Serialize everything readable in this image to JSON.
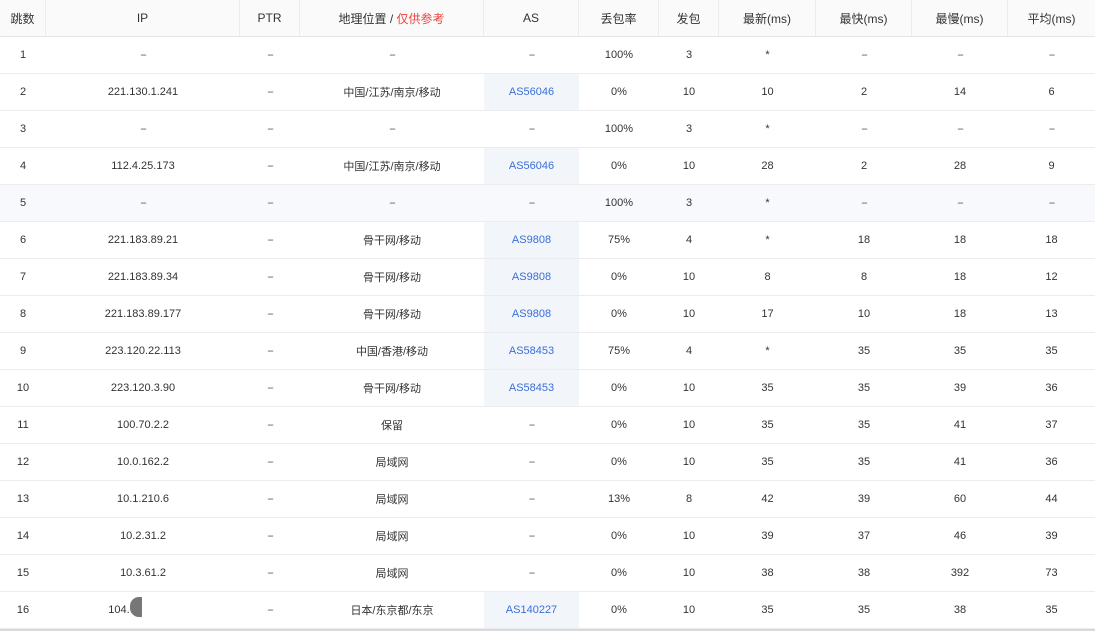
{
  "header": {
    "hop": "跳数",
    "ip": "IP",
    "ptr": "PTR",
    "geo": "地理位置 / ",
    "geo_note": "仅供参考",
    "as": "AS",
    "loss": "丢包率",
    "sent": "发包",
    "last": "最新(ms)",
    "best": "最快(ms)",
    "worst": "最慢(ms)",
    "avg": "平均(ms)"
  },
  "rows": [
    {
      "hop": "1",
      "ip": "--",
      "ptr": "--",
      "geo": "--",
      "as": "--",
      "loss": "100%",
      "sent": "3",
      "last": "*",
      "best": "--",
      "worst": "--",
      "avg": "--"
    },
    {
      "hop": "2",
      "ip": "221.130.1.241",
      "ptr": "--",
      "geo": "中国/江苏/南京/移动",
      "as": "AS56046",
      "loss": "0%",
      "sent": "10",
      "last": "10",
      "best": "2",
      "worst": "14",
      "avg": "6"
    },
    {
      "hop": "3",
      "ip": "--",
      "ptr": "--",
      "geo": "--",
      "as": "--",
      "loss": "100%",
      "sent": "3",
      "last": "*",
      "best": "--",
      "worst": "--",
      "avg": "--"
    },
    {
      "hop": "4",
      "ip": "112.4.25.173",
      "ptr": "--",
      "geo": "中国/江苏/南京/移动",
      "as": "AS56046",
      "loss": "0%",
      "sent": "10",
      "last": "28",
      "best": "2",
      "worst": "28",
      "avg": "9"
    },
    {
      "hop": "5",
      "ip": "--",
      "ptr": "--",
      "geo": "--",
      "as": "--",
      "loss": "100%",
      "sent": "3",
      "last": "*",
      "best": "--",
      "worst": "--",
      "avg": "--"
    },
    {
      "hop": "6",
      "ip": "221.183.89.21",
      "ptr": "--",
      "geo": "骨干网/移动",
      "as": "AS9808",
      "loss": "75%",
      "sent": "4",
      "last": "*",
      "best": "18",
      "worst": "18",
      "avg": "18"
    },
    {
      "hop": "7",
      "ip": "221.183.89.34",
      "ptr": "--",
      "geo": "骨干网/移动",
      "as": "AS9808",
      "loss": "0%",
      "sent": "10",
      "last": "8",
      "best": "8",
      "worst": "18",
      "avg": "12"
    },
    {
      "hop": "8",
      "ip": "221.183.89.177",
      "ptr": "--",
      "geo": "骨干网/移动",
      "as": "AS9808",
      "loss": "0%",
      "sent": "10",
      "last": "17",
      "best": "10",
      "worst": "18",
      "avg": "13"
    },
    {
      "hop": "9",
      "ip": "223.120.22.113",
      "ptr": "--",
      "geo": "中国/香港/移动",
      "as": "AS58453",
      "loss": "75%",
      "sent": "4",
      "last": "*",
      "best": "35",
      "worst": "35",
      "avg": "35"
    },
    {
      "hop": "10",
      "ip": "223.120.3.90",
      "ptr": "--",
      "geo": "骨干网/移动",
      "as": "AS58453",
      "loss": "0%",
      "sent": "10",
      "last": "35",
      "best": "35",
      "worst": "39",
      "avg": "36"
    },
    {
      "hop": "11",
      "ip": "100.70.2.2",
      "ptr": "--",
      "geo": "保留",
      "as": "--",
      "loss": "0%",
      "sent": "10",
      "last": "35",
      "best": "35",
      "worst": "41",
      "avg": "37"
    },
    {
      "hop": "12",
      "ip": "10.0.162.2",
      "ptr": "--",
      "geo": "局域网",
      "as": "--",
      "loss": "0%",
      "sent": "10",
      "last": "35",
      "best": "35",
      "worst": "41",
      "avg": "36"
    },
    {
      "hop": "13",
      "ip": "10.1.210.6",
      "ptr": "--",
      "geo": "局域网",
      "as": "--",
      "loss": "13%",
      "sent": "8",
      "last": "42",
      "best": "39",
      "worst": "60",
      "avg": "44"
    },
    {
      "hop": "14",
      "ip": "10.2.31.2",
      "ptr": "--",
      "geo": "局域网",
      "as": "--",
      "loss": "0%",
      "sent": "10",
      "last": "39",
      "best": "37",
      "worst": "46",
      "avg": "39"
    },
    {
      "hop": "15",
      "ip": "10.3.61.2",
      "ptr": "--",
      "geo": "局域网",
      "as": "--",
      "loss": "0%",
      "sent": "10",
      "last": "38",
      "best": "38",
      "worst": "392",
      "avg": "73"
    },
    {
      "hop": "16",
      "ip": "104.",
      "ptr": "--",
      "geo": "日本/东京都/东京",
      "as": "AS140227",
      "loss": "0%",
      "sent": "10",
      "last": "35",
      "best": "35",
      "worst": "38",
      "avg": "35"
    }
  ],
  "highlight_row": 5,
  "colors": {
    "as_link": "#3a6fd8",
    "note_red": "#e8453c",
    "hover_row": "#f7f9fd"
  }
}
